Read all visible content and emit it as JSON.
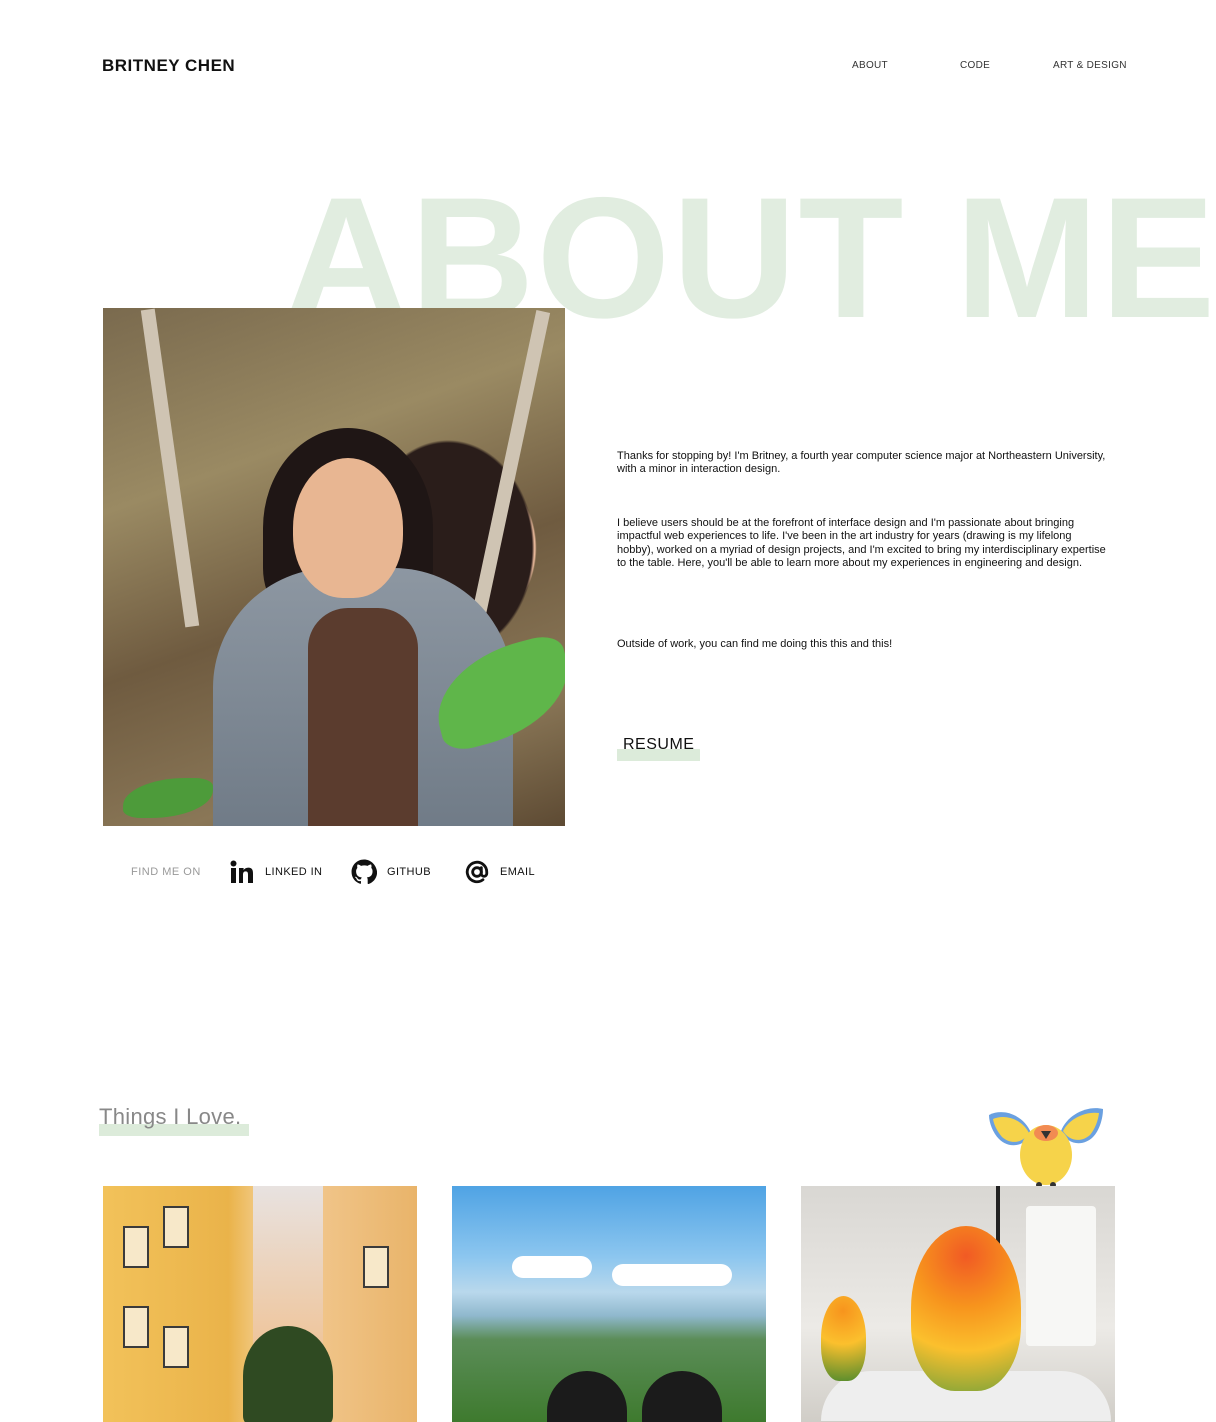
{
  "header": {
    "brand": "BRITNEY CHEN",
    "nav": [
      "ABOUT",
      "CODE",
      "ART & DESIGN"
    ]
  },
  "hero": {
    "title": "ABOUT ME"
  },
  "bio": {
    "paragraphs": [
      "Thanks for stopping by! I'm Britney, a fourth year computer science major at Northeastern University, with a minor in interaction design.",
      "I believe users should be at the forefront of interface design and I'm passionate about bringing impactful web experiences to life. I've been in the art industry for years (drawing is my lifelong hobby), worked on a myriad of design projects, and I'm excited to bring my interdisciplinary expertise to the table. Here, you'll be able to learn more about my experiences in engineering and design.",
      "Outside of work, you can find me doing this this and this!"
    ],
    "resume_label": "RESUME"
  },
  "social": {
    "label": "FIND ME ON",
    "links": [
      {
        "label": "LINKED IN",
        "icon": "linkedin-icon"
      },
      {
        "label": "GITHUB",
        "icon": "github-icon"
      },
      {
        "label": "EMAIL",
        "icon": "at-sign-icon"
      }
    ]
  },
  "things": {
    "title": "Things I Love."
  },
  "colors": {
    "accent_highlight": "#dcebda",
    "hero_text": "#e1ede0",
    "muted_text": "#999999"
  }
}
